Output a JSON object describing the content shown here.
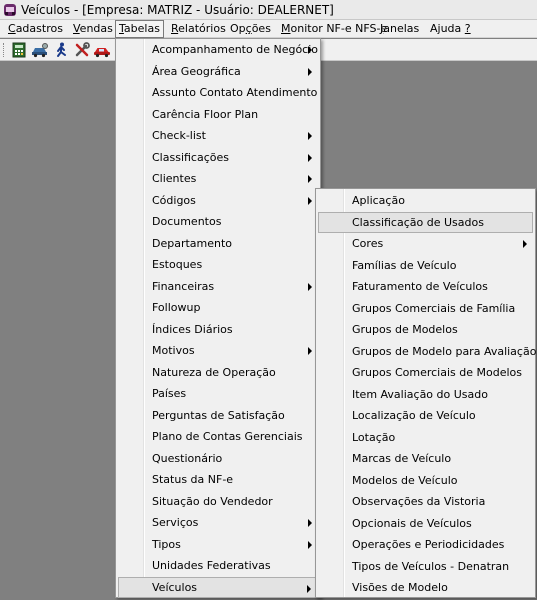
{
  "window": {
    "title": "Veículos - [Empresa: MATRIZ - Usuário: DEALERNET]",
    "icon": "car-app-icon"
  },
  "menubar": {
    "items": [
      {
        "label": "Cadastros",
        "accel": "C",
        "rest": "adastros"
      },
      {
        "label": "Vendas",
        "accel": "V",
        "rest": "endas"
      },
      {
        "label": "Tabelas",
        "accel": "T",
        "rest": "abelas",
        "active": true
      },
      {
        "label": "Relatórios",
        "accel": "R",
        "rest": "elatórios"
      },
      {
        "label": "Opções",
        "pre": "Op",
        "accel": "ç",
        "rest": "ões"
      },
      {
        "label": "Monitor NF-e NFS-e",
        "accel": "M",
        "rest": "onitor NF-e NFS-e"
      },
      {
        "label": "Janelas",
        "accel": "J",
        "rest": "anelas"
      },
      {
        "label": "Ajuda ?",
        "pre": "Ajuda ",
        "accel": "?",
        "rest": ""
      }
    ]
  },
  "toolbar": {
    "buttons": [
      "calculator-icon",
      "car-tools-icon",
      "running-man-icon",
      "tools-icon",
      "red-car-icon"
    ]
  },
  "tabelas_menu": {
    "items": [
      {
        "label": "Acompanhamento de Negócio",
        "submenu": true
      },
      {
        "label": "Área Geográfica",
        "submenu": true
      },
      {
        "label": "Assunto Contato Atendimento",
        "submenu": false
      },
      {
        "label": "Carência Floor Plan",
        "submenu": false
      },
      {
        "label": "Check-list",
        "submenu": true
      },
      {
        "label": "Classificações",
        "submenu": true
      },
      {
        "label": "Clientes",
        "submenu": true
      },
      {
        "label": "Códigos",
        "submenu": true
      },
      {
        "label": "Documentos",
        "submenu": false
      },
      {
        "label": "Departamento",
        "submenu": false
      },
      {
        "label": "Estoques",
        "submenu": false
      },
      {
        "label": "Financeiras",
        "submenu": true
      },
      {
        "label": "Followup",
        "submenu": false
      },
      {
        "label": "Índices Diários",
        "submenu": false
      },
      {
        "label": "Motivos",
        "submenu": true
      },
      {
        "label": "Natureza de Operação",
        "submenu": false
      },
      {
        "label": "Países",
        "submenu": false
      },
      {
        "label": "Perguntas de Satisfação",
        "submenu": false
      },
      {
        "label": "Plano de Contas Gerenciais",
        "submenu": false
      },
      {
        "label": "Questionário",
        "submenu": false
      },
      {
        "label": "Status da NF-e",
        "submenu": false
      },
      {
        "label": "Situação do Vendedor",
        "submenu": false
      },
      {
        "label": "Serviços",
        "submenu": true
      },
      {
        "label": "Tipos",
        "submenu": true
      },
      {
        "label": "Unidades Federativas",
        "submenu": false
      },
      {
        "label": "Veículos",
        "submenu": true,
        "highlighted": true
      }
    ]
  },
  "veiculos_menu": {
    "items": [
      {
        "label": "Aplicação",
        "submenu": false
      },
      {
        "label": "Classificação de Usados",
        "submenu": false,
        "highlighted": true
      },
      {
        "label": "Cores",
        "submenu": true
      },
      {
        "label": "Famílias de Veículo",
        "submenu": false
      },
      {
        "label": "Faturamento de Veículos",
        "submenu": false
      },
      {
        "label": "Grupos Comerciais de Família",
        "submenu": false
      },
      {
        "label": "Grupos de Modelos",
        "submenu": false
      },
      {
        "label": "Grupos de Modelo para Avaliação",
        "submenu": false
      },
      {
        "label": "Grupos Comerciais de Modelos",
        "submenu": false
      },
      {
        "label": "Item Avaliação do Usado",
        "submenu": false
      },
      {
        "label": "Localização de Veículo",
        "submenu": false
      },
      {
        "label": "Lotação",
        "submenu": false
      },
      {
        "label": "Marcas de Veículo",
        "submenu": false
      },
      {
        "label": "Modelos de Veículo",
        "submenu": false
      },
      {
        "label": "Observações da Vistoria",
        "submenu": false
      },
      {
        "label": "Opcionais de Veículos",
        "submenu": false
      },
      {
        "label": "Operações e Periodicidades",
        "submenu": false
      },
      {
        "label": "Tipos de Veículos - Denatran",
        "submenu": false
      },
      {
        "label": "Visões de Modelo",
        "submenu": false
      }
    ]
  }
}
